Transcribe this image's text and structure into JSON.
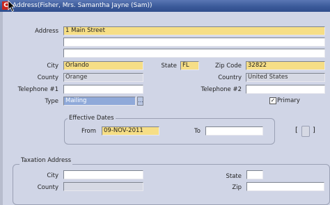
{
  "window": {
    "title": "Address(Fisher, Mrs. Samantha Jayne (Sam))"
  },
  "form": {
    "address_label": "Address",
    "address_line1": "1 Main Street",
    "address_line2": "",
    "address_line3": "",
    "city_label": "City",
    "city_value": "Orlando",
    "state_label": "State",
    "state_value": "FL",
    "zip_label": "Zip Code",
    "zip_value": "32822",
    "county_label": "County",
    "county_value": "Orange",
    "country_label": "Country",
    "country_value": "United States",
    "tel1_label": "Telephone #1",
    "tel1_value": "",
    "tel2_label": "Telephone #2",
    "tel2_value": "",
    "type_label": "Type",
    "type_value": "Mailing",
    "lov_symbol": "…",
    "primary_label": "Primary",
    "primary_checked": "✓"
  },
  "effective": {
    "title": "Effective Dates",
    "from_label": "From",
    "from_value": "09-NOV-2011",
    "to_label": "To",
    "to_value": ""
  },
  "descflex": {
    "open": "[",
    "close": "]"
  },
  "taxation": {
    "title": "Taxation Address",
    "city_label": "City",
    "city_value": "",
    "county_label": "County",
    "county_value": "",
    "state_label": "State",
    "state_value": "",
    "zip_label": "Zip",
    "zip_value": ""
  },
  "colors": {
    "required": "#f6de86",
    "titlebar": "#3b5a9a",
    "background": "#d0d5e6"
  }
}
